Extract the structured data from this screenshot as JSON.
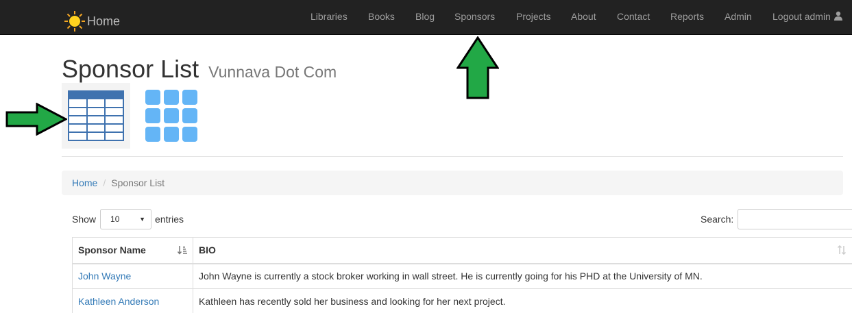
{
  "navbar": {
    "brand_label": "Home",
    "brand_icon": "sun-icon",
    "items": [
      {
        "label": "Libraries"
      },
      {
        "label": "Books"
      },
      {
        "label": "Blog"
      },
      {
        "label": "Sponsors"
      },
      {
        "label": "Projects"
      },
      {
        "label": "About"
      },
      {
        "label": "Contact"
      },
      {
        "label": "Reports"
      },
      {
        "label": "Admin"
      }
    ],
    "logout_label": "Logout admin",
    "user_icon": "user-icon"
  },
  "header": {
    "title": "Sponsor List",
    "subtitle": "Vunnava Dot Com"
  },
  "view_toggle": {
    "table_view_icon": "table-view-icon",
    "grid_view_icon": "grid-view-icon",
    "grid_color": "#64b5f6",
    "table_color": "#3f72af"
  },
  "breadcrumb": {
    "home": "Home",
    "separator": "/",
    "current": "Sponsor List"
  },
  "table_controls": {
    "show_label": "Show",
    "page_size": "10",
    "entries_label": "entries",
    "search_label": "Search:",
    "search_value": ""
  },
  "table": {
    "columns": [
      "Sponsor Name",
      "BIO"
    ],
    "rows": [
      {
        "name": "John Wayne",
        "bio": "John Wayne is currently a stock broker working in wall street. He is currently going for his PHD at the University of MN."
      },
      {
        "name": "Kathleen Anderson",
        "bio": "Kathleen has recently sold her business and looking for her next project."
      }
    ]
  },
  "annotations": {
    "arrow_color": "#22a846",
    "arrow_outline": "#000000"
  }
}
